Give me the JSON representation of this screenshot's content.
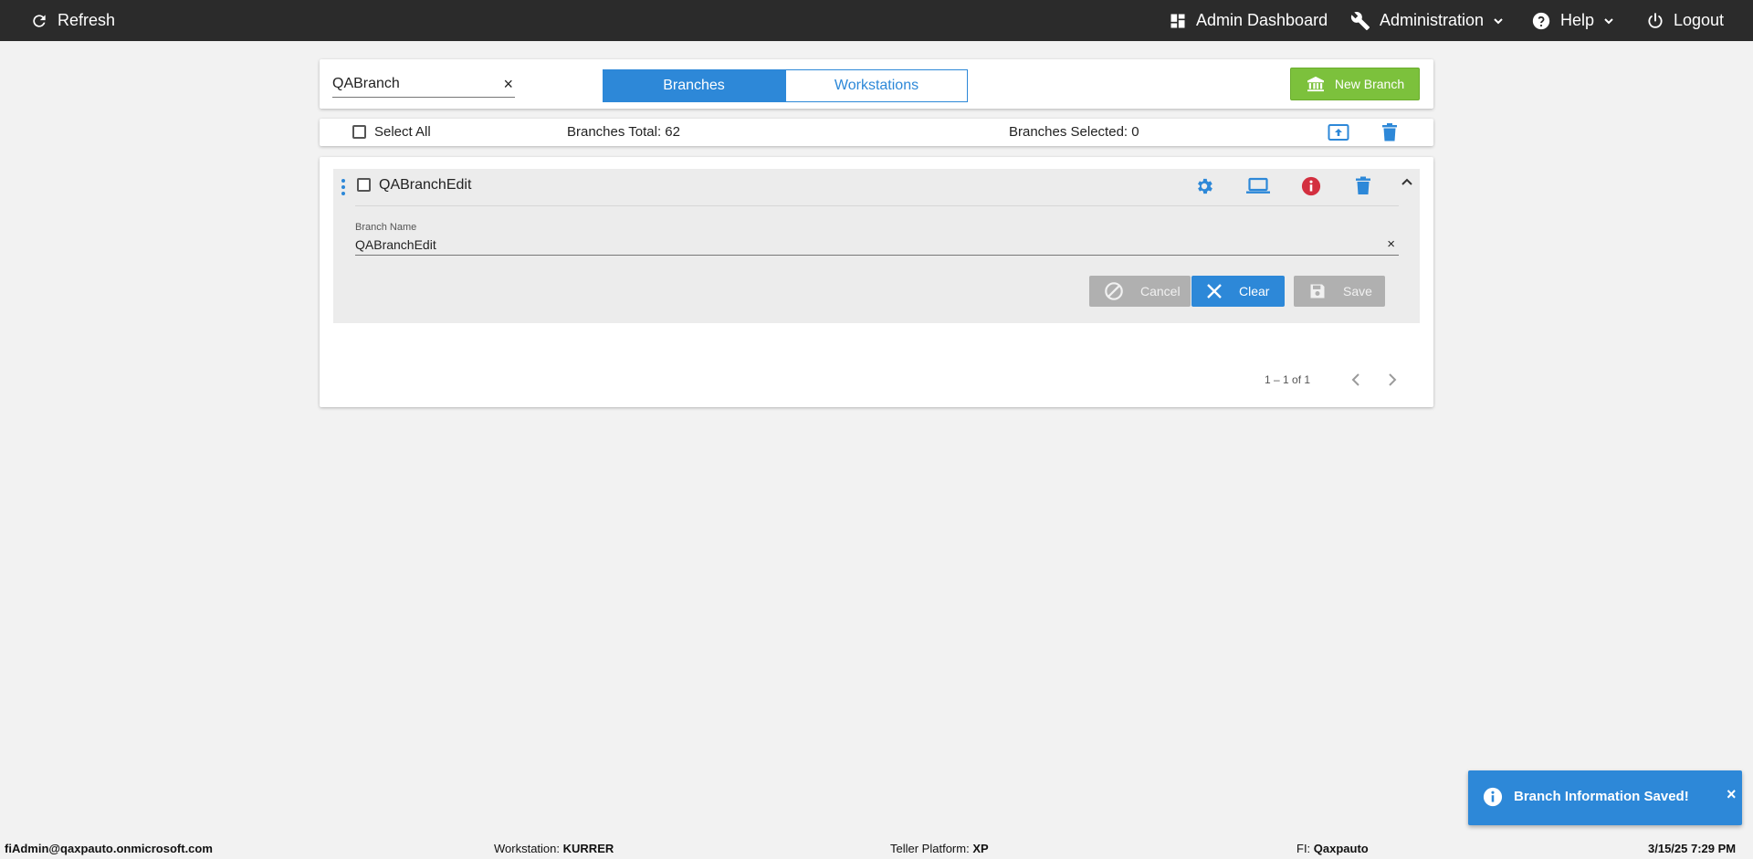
{
  "topbar": {
    "refresh_label": "Refresh",
    "admin_dashboard_label": "Admin Dashboard",
    "administration_label": "Administration",
    "help_label": "Help",
    "logout_label": "Logout"
  },
  "search": {
    "value": "QABranch",
    "clear_symbol": "×"
  },
  "tabs": [
    {
      "label": "Branches",
      "active": true
    },
    {
      "label": "Workstations",
      "active": false
    }
  ],
  "new_branch_label": "New Branch",
  "summary": {
    "select_all_label": "Select All",
    "total_label": "Branches Total: 62",
    "selected_label": "Branches Selected: 0"
  },
  "branch_row": {
    "title": "QABranchEdit",
    "field_label": "Branch Name",
    "field_value": "QABranchEdit",
    "clear_symbol": "×",
    "cancel_label": "Cancel",
    "clear_label": "Clear",
    "save_label": "Save"
  },
  "pagination": {
    "range_text": "1 – 1 of 1"
  },
  "toast": {
    "message": "Branch Information Saved!",
    "close_symbol": "×"
  },
  "footer": {
    "user": "fiAdmin@qaxpauto.onmicrosoft.com",
    "workstation_label": "Workstation:",
    "workstation_value": "KURRER",
    "teller_platform_label": "Teller Platform:",
    "teller_platform_value": "XP",
    "fi_label": "FI:",
    "fi_value": "Qaxpauto",
    "datetime": "3/15/25 7:29 PM"
  },
  "colors": {
    "topbar_bg": "#2b2b2b",
    "accent_blue": "#2d88d8",
    "new_branch_green": "#7cc13c",
    "info_red": "#d32f3f",
    "disabled_gray": "#b0b0b0"
  },
  "icons": {
    "refresh": "refresh-icon",
    "dashboard": "dashboard-icon",
    "wrench": "wrench-icon",
    "help": "help-icon",
    "power": "power-icon",
    "bank": "bank-icon",
    "export": "export-icon",
    "trash": "trash-icon",
    "drag": "drag-handle-icon",
    "gear": "gear-icon",
    "laptop": "laptop-icon",
    "info": "info-icon",
    "collapse": "chevron-up-icon",
    "cancel": "block-icon",
    "clear": "close-icon",
    "save": "floppy-icon"
  }
}
